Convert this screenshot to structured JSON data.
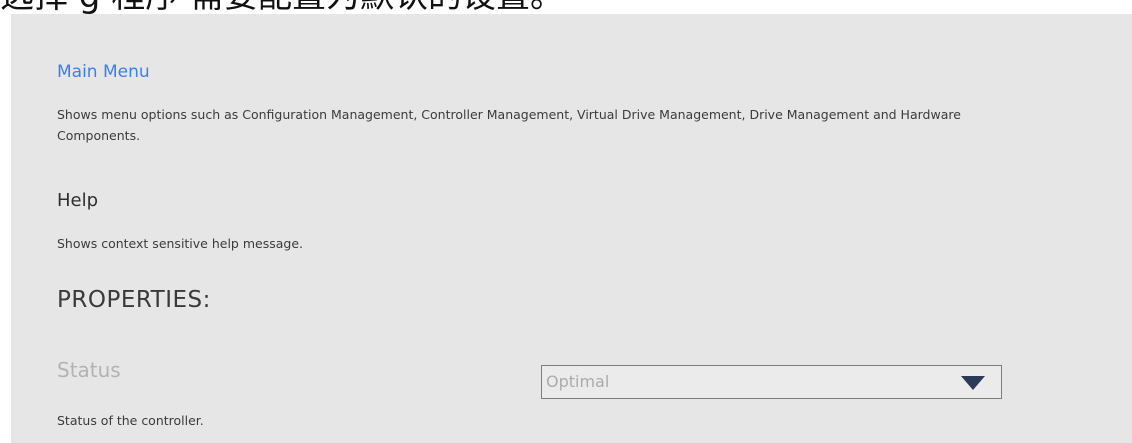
{
  "top_strip": {
    "text": "选择 g 程序 需要配置为默认的设置。"
  },
  "main_menu": {
    "title": "Main Menu",
    "description": "Shows menu options such as Configuration Management, Controller Management, Virtual Drive Management, Drive Management and Hardware Components."
  },
  "help": {
    "title": "Help",
    "description": "Shows context sensitive help message."
  },
  "properties": {
    "heading": "PROPERTIES:",
    "status": {
      "label": "Status",
      "value": "Optimal",
      "description": "Status of the controller."
    }
  },
  "icons": {
    "dropdown": "triangle-down-icon"
  },
  "colors": {
    "link": "#3a7ff0",
    "panel_background": "#e6e6e6",
    "disabled_text": "#b3b3b3",
    "select_border": "#7d7d7d"
  }
}
